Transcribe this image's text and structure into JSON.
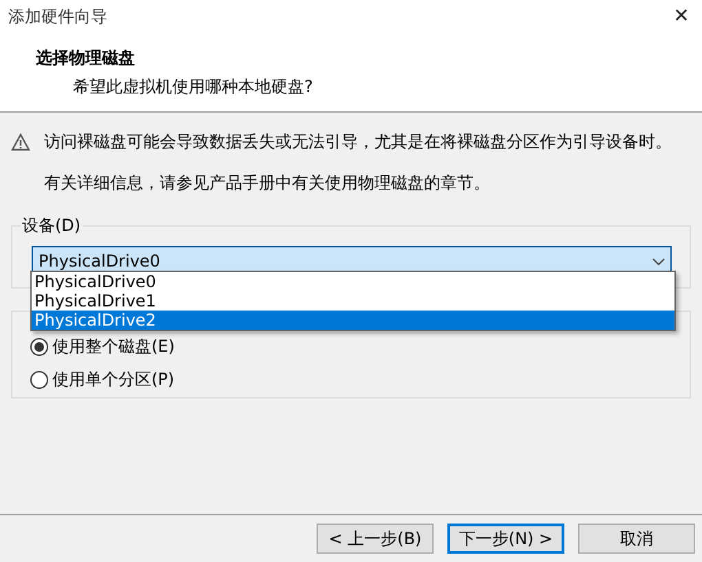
{
  "window": {
    "title": "添加硬件向导",
    "close": "✕"
  },
  "header": {
    "title": "选择物理磁盘",
    "subtitle": "希望此虚拟机使用哪种本地硬盘?"
  },
  "warning": "访问裸磁盘可能会导致数据丢失或无法引导，尤其是在将裸磁盘分区作为引导设备时。",
  "info": "有关详细信息，请参见产品手册中有关使用物理磁盘的章节。",
  "device": {
    "label": "设备(D)",
    "value": "PhysicalDrive0",
    "expanded": true,
    "options": [
      {
        "label": "PhysicalDrive0",
        "highlighted": false
      },
      {
        "label": "PhysicalDrive1",
        "highlighted": false
      },
      {
        "label": "PhysicalDrive2",
        "highlighted": true
      }
    ]
  },
  "usage": {
    "options": [
      {
        "label": "使用整个磁盘(E)",
        "selected": true
      },
      {
        "label": "使用单个分区(P)",
        "selected": false
      }
    ]
  },
  "buttons": [
    {
      "label": "< 上一步(B)",
      "focused": false
    },
    {
      "label": "下一步(N) >",
      "focused": true
    },
    {
      "label": "取消",
      "focused": false
    }
  ]
}
